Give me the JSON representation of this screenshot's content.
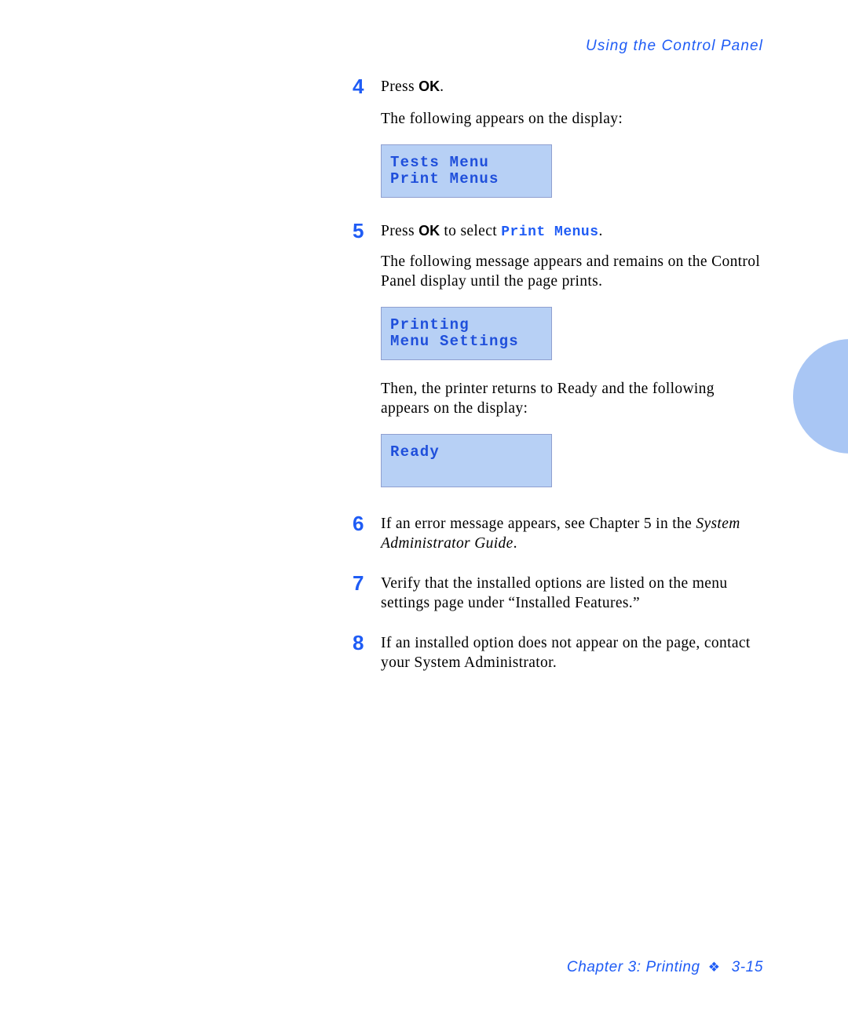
{
  "header": {
    "running_head": "Using the Control Panel"
  },
  "steps": [
    {
      "number": "4",
      "line_pre": "Press ",
      "ui_key": "OK",
      "line_post": ".",
      "paragraph": "The following appears on the display:",
      "display": {
        "line1": "Tests Menu",
        "line2": "Print Menus"
      }
    },
    {
      "number": "5",
      "line_pre": "Press ",
      "ui_key": "OK",
      "line_mid": " to select ",
      "mono_value": "Print Menus",
      "line_post": ".",
      "paragraph": "The following message appears and remains on the Control Panel display until the page prints.",
      "display": {
        "line1": "Printing",
        "line2": "Menu Settings"
      },
      "paragraph2": "Then, the printer returns to Ready and the following appears on the display:",
      "display2": {
        "line1": "Ready",
        "line2": ""
      }
    },
    {
      "number": "6",
      "text_pre": "If an error message appears, see Chapter 5 in the ",
      "text_italic": "System Administrator Guide",
      "text_post": "."
    },
    {
      "number": "7",
      "text": "Verify that the installed options are listed on the menu settings page under “Installed Features.”"
    },
    {
      "number": "8",
      "text": "If an installed option does not appear on the page, contact your System Administrator."
    }
  ],
  "footer": {
    "chapter": "Chapter 3: Printing",
    "ornament": "❖",
    "page": "3-15"
  },
  "colors": {
    "accent_blue": "#1f5cf5",
    "lcd_background": "#b7d0f5",
    "lcd_text": "#1f4fdb",
    "tab_circle": "#a9c6f4",
    "body_text": "#000000"
  }
}
